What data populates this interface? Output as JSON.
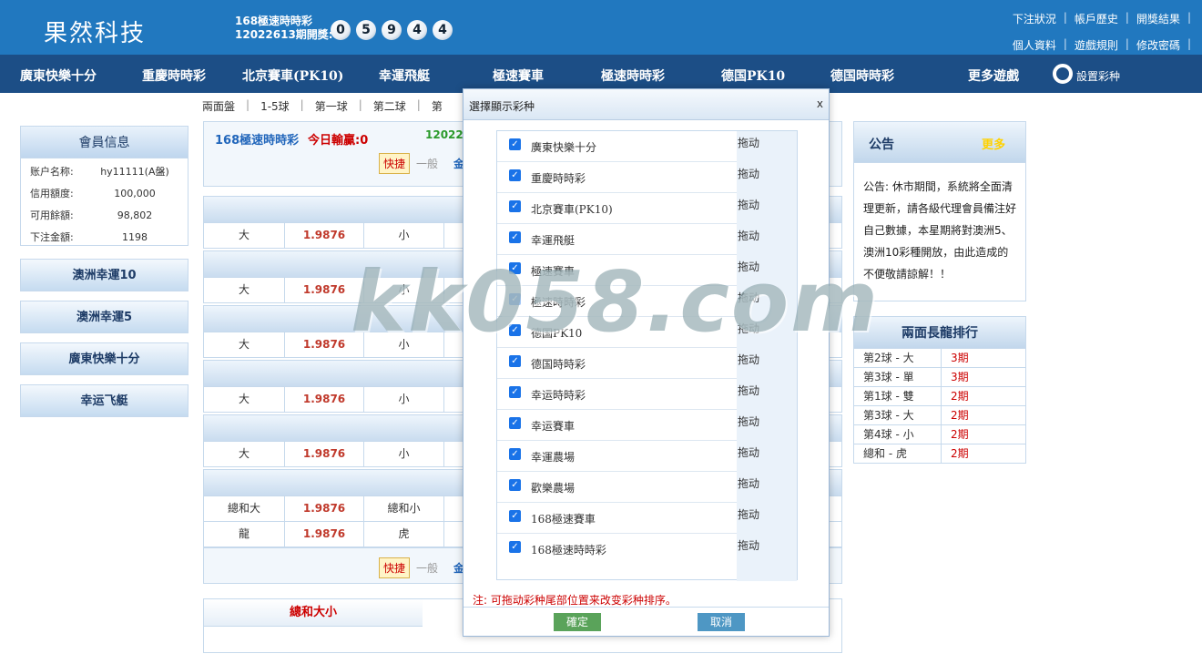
{
  "header": {
    "logo": "果然科技",
    "lottery_name": "168極速時時彩",
    "period_text": "12022613期開獎:",
    "balls": [
      "0",
      "5",
      "9",
      "4",
      "4"
    ],
    "links_row1": [
      "下注狀況",
      "帳戶歷史",
      "開獎結果"
    ],
    "links_row2": [
      "個人資料",
      "遊戲規則",
      "修改密碼"
    ]
  },
  "nav": {
    "items": [
      "廣東快樂十分",
      "重慶時時彩",
      "北京賽車(PK10)",
      "幸運飛艇",
      "極速賽車",
      "極速時時彩",
      "德国PK10",
      "德国時時彩",
      "更多遊戲"
    ],
    "settings_label": "設置彩种"
  },
  "subnav": [
    "兩面盤",
    "|",
    "1-5球",
    "|",
    "第一球",
    "|",
    "第二球",
    "|",
    "第"
  ],
  "member": {
    "title": "會員信息",
    "rows": [
      {
        "k": "账户名称:",
        "v": "hy11111(A盤)"
      },
      {
        "k": "信用額度:",
        "v": "100,000"
      },
      {
        "k": "可用餘額:",
        "v": "98,802"
      },
      {
        "k": "下注金額:",
        "v": "1198"
      }
    ],
    "buttons": [
      "澳洲幸運10",
      "澳洲幸運5",
      "廣東快樂十分",
      "幸运飞艇"
    ]
  },
  "infobar": {
    "name": "168極速時時彩",
    "today": "今日輸贏:0",
    "period": "1202261",
    "fast": "快捷",
    "normal": "一般",
    "gold": "金"
  },
  "grid": {
    "rows": [
      {
        "a": "大",
        "b": "1.9876",
        "c": "小"
      },
      {
        "a": "大",
        "b": "1.9876",
        "c": "小"
      },
      {
        "a": "大",
        "b": "1.9876",
        "c": "小"
      },
      {
        "a": "大",
        "b": "1.9876",
        "c": "小"
      },
      {
        "a": "大",
        "b": "1.9876",
        "c": "小"
      }
    ],
    "total_rows": [
      {
        "a": "總和大",
        "b": "1.9876",
        "c": "總和小"
      },
      {
        "a": "龍",
        "b": "1.9876",
        "c": "虎"
      }
    ]
  },
  "bottom": {
    "fast": "快捷",
    "normal": "一般",
    "gold": "金",
    "sum_title": "總和大小"
  },
  "announcement": {
    "title": "公告",
    "more": "更多",
    "text": "公告: 休市期間，系統將全面清理更新，請各級代理會員備注好自己數據，本星期將對澳洲5、澳洲10彩種開放，由此造成的不便敬請諒解！！"
  },
  "dragon": {
    "title": "兩面長龍排行",
    "rows": [
      {
        "a": "第2球 - 大",
        "b": "3期"
      },
      {
        "a": "第3球 - 單",
        "b": "3期"
      },
      {
        "a": "第1球 - 雙",
        "b": "2期"
      },
      {
        "a": "第3球 - 大",
        "b": "2期"
      },
      {
        "a": "第4球 - 小",
        "b": "2期"
      },
      {
        "a": "總和  - 虎",
        "b": "2期"
      }
    ]
  },
  "modal": {
    "title": "選擇顯示彩种",
    "close": "x",
    "drag": "拖动",
    "items": [
      "廣東快樂十分",
      "重慶時時彩",
      "北京賽車(PK10)",
      "幸運飛艇",
      "極速賽車",
      "極速時時彩",
      "德国PK10",
      "德国時時彩",
      "幸运時時彩",
      "幸运賽車",
      "幸運農場",
      "歡樂農場",
      "168極速賽車",
      "168極速時時彩"
    ],
    "note": "注: 可拖动彩种尾部位置来改变彩种排序。",
    "ok": "確定",
    "cancel": "取消"
  },
  "watermark": "kk058.com"
}
